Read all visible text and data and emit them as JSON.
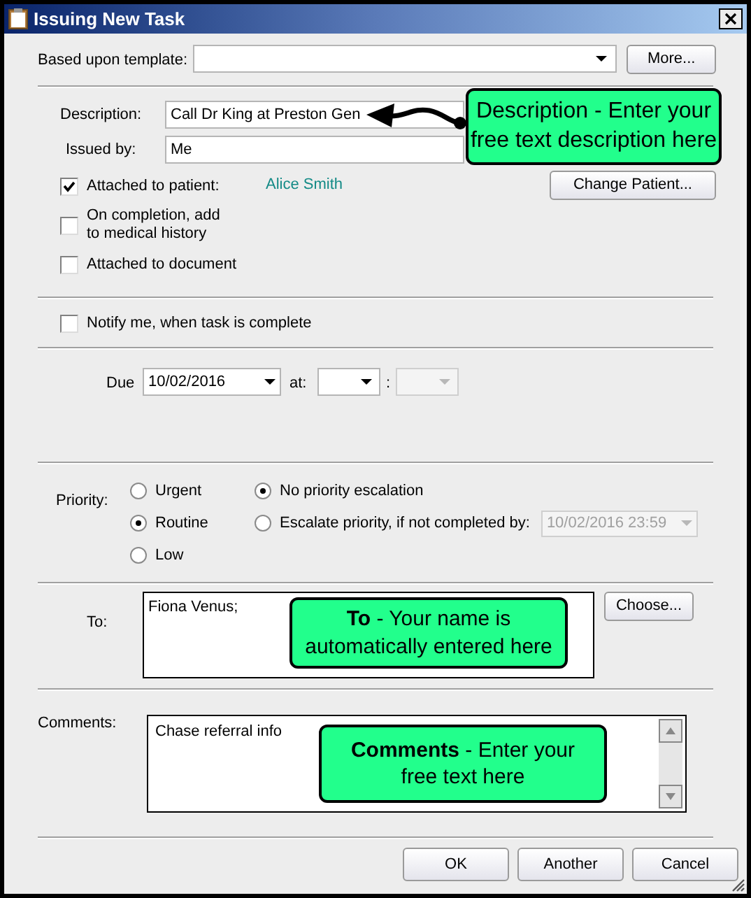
{
  "window": {
    "title": "Issuing New Task"
  },
  "template": {
    "label": "Based upon template:",
    "button": "More..."
  },
  "description": {
    "label": "Description:",
    "value": "Call Dr King at Preston Gen"
  },
  "issued_by": {
    "label": "Issued by:",
    "value": "Me"
  },
  "patient": {
    "label": "Attached to patient:",
    "checked": true,
    "name": "Alice Smith",
    "button": "Change Patient..."
  },
  "options": [
    {
      "label": "On completion, add\nto medical history",
      "checked": false
    },
    {
      "label": "Attached to document",
      "checked": false
    }
  ],
  "notify": {
    "label": "Notify me, when task is complete",
    "checked": false
  },
  "due": {
    "label": "Due",
    "date": "10/02/2016",
    "at_label": "at:",
    "separator": ":"
  },
  "priority": {
    "label": "Priority:",
    "levels": [
      {
        "label": "Urgent",
        "selected": false
      },
      {
        "label": "Routine",
        "selected": true
      },
      {
        "label": "Low",
        "selected": false
      }
    ],
    "escalation": [
      {
        "label": "No priority escalation",
        "selected": true
      },
      {
        "label": "Escalate priority, if not completed by:",
        "selected": false
      }
    ],
    "escalate_by": {
      "value": "10/02/2016 23:59",
      "disabled": true
    }
  },
  "to": {
    "label": "To:",
    "value": "Fiona Venus;",
    "button": "Choose..."
  },
  "comments": {
    "label": "Comments:",
    "value": "Chase referral info"
  },
  "buttons": [
    "OK",
    "Another",
    "Cancel"
  ],
  "callouts": [
    {
      "text": "Description - Enter your free text description here"
    },
    {
      "text": "**To** - Your name is automatically entered here"
    },
    {
      "text": "**Comments** - Enter your free text here"
    }
  ]
}
